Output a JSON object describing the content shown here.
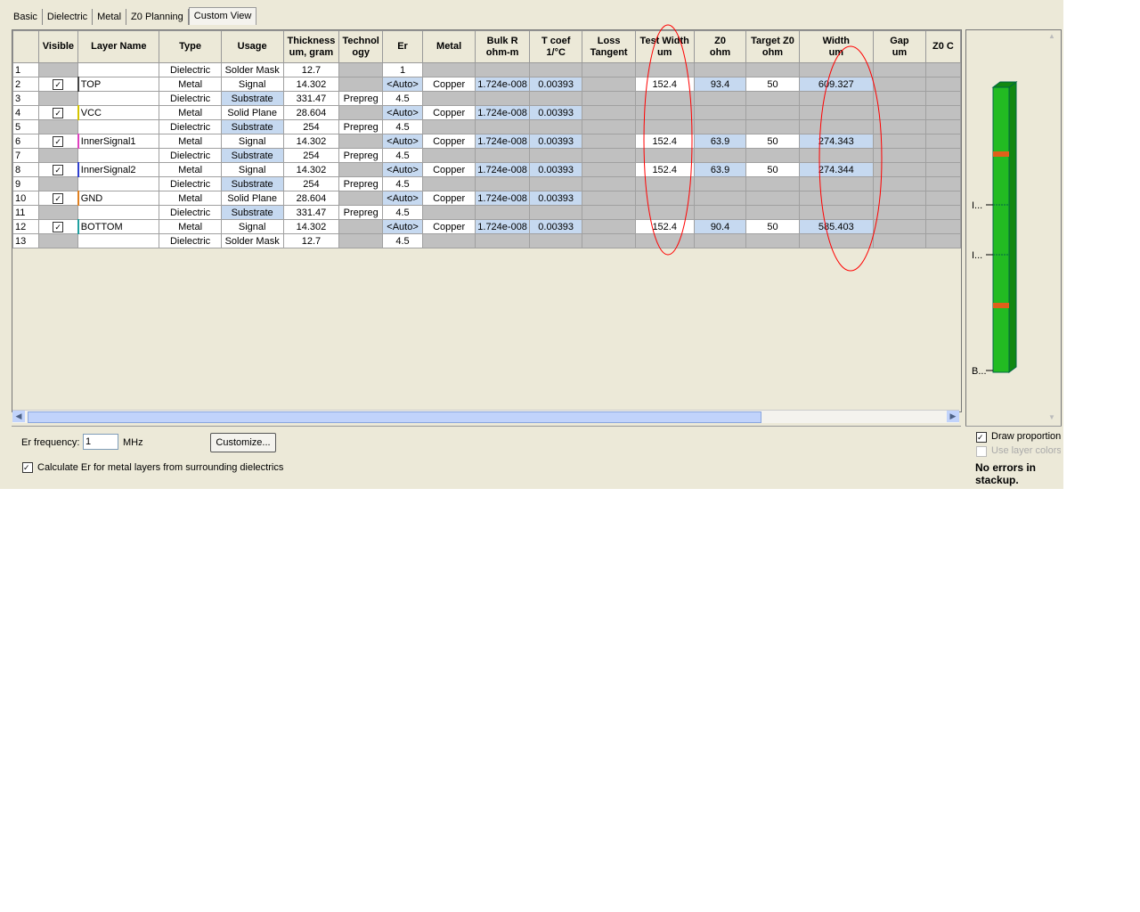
{
  "tabs": [
    "Basic",
    "Dielectric",
    "Metal",
    "Z0 Planning",
    "Custom View"
  ],
  "active_tab": 4,
  "columns": [
    "",
    "Visible",
    "Layer Name",
    "Type",
    "Usage",
    "Thickness\num, gram",
    "Technol\nogy",
    "Er",
    "Metal",
    "Bulk R\nohm-m",
    "T coef\n1/°C",
    "Loss\nTangent",
    "Test Width\num",
    "Z0\nohm",
    "Target Z0\nohm",
    "Width\num",
    "Gap\num",
    "Z0 C"
  ],
  "rows": [
    {
      "cells": [
        "1",
        "",
        "",
        "Dielectric",
        "Solder Mask",
        "12.7",
        "",
        "1",
        "",
        "",
        "",
        "",
        "",
        "",
        "",
        "",
        "",
        ""
      ],
      "cls": "ggwwwwgwgggggggggg"
    },
    {
      "cells": [
        "2",
        "☑",
        "TOP",
        "Metal",
        "Signal",
        "14.302",
        "",
        "<Auto>",
        "Copper",
        "1.724e-008",
        "0.00393",
        "",
        "152.4",
        "93.4",
        "50",
        "609.327",
        "",
        ""
      ],
      "cls": "gwwwwwgbwbbgwbwbgg"
    },
    {
      "cells": [
        "3",
        "",
        "",
        "Dielectric",
        "Substrate",
        "331.47",
        "Prepreg",
        "4.5",
        "",
        "",
        "",
        "",
        "",
        "",
        "",
        "",
        "",
        ""
      ],
      "cls": "ggwwbwwwgggggggggg"
    },
    {
      "cells": [
        "4",
        "☑",
        "VCC",
        "Metal",
        "Solid Plane",
        "28.604",
        "",
        "<Auto>",
        "Copper",
        "1.724e-008",
        "0.00393",
        "",
        "",
        "",
        "",
        "",
        "",
        ""
      ],
      "cls": "gwwwwwgbwbbggggggg"
    },
    {
      "cells": [
        "5",
        "",
        "",
        "Dielectric",
        "Substrate",
        "254",
        "Prepreg",
        "4.5",
        "",
        "",
        "",
        "",
        "",
        "",
        "",
        "",
        "",
        ""
      ],
      "cls": "ggwwbwwwgggggggggg"
    },
    {
      "cells": [
        "6",
        "☑",
        "InnerSignal1",
        "Metal",
        "Signal",
        "14.302",
        "",
        "<Auto>",
        "Copper",
        "1.724e-008",
        "0.00393",
        "",
        "152.4",
        "63.9",
        "50",
        "274.343",
        "",
        ""
      ],
      "cls": "gwwwwwgbwbbgwbwbgg"
    },
    {
      "cells": [
        "7",
        "",
        "",
        "Dielectric",
        "Substrate",
        "254",
        "Prepreg",
        "4.5",
        "",
        "",
        "",
        "",
        "",
        "",
        "",
        "",
        "",
        ""
      ],
      "cls": "ggwwbwwwgggggggggg"
    },
    {
      "cells": [
        "8",
        "☑",
        "InnerSignal2",
        "Metal",
        "Signal",
        "14.302",
        "",
        "<Auto>",
        "Copper",
        "1.724e-008",
        "0.00393",
        "",
        "152.4",
        "63.9",
        "50",
        "274.344",
        "",
        ""
      ],
      "cls": "gwwwwwgbwbbgwbwbgg"
    },
    {
      "cells": [
        "9",
        "",
        "",
        "Dielectric",
        "Substrate",
        "254",
        "Prepreg",
        "4.5",
        "",
        "",
        "",
        "",
        "",
        "",
        "",
        "",
        "",
        ""
      ],
      "cls": "ggwwbwwwgggggggggg"
    },
    {
      "cells": [
        "10",
        "☑",
        "GND",
        "Metal",
        "Solid Plane",
        "28.604",
        "",
        "<Auto>",
        "Copper",
        "1.724e-008",
        "0.00393",
        "",
        "",
        "",
        "",
        "",
        "",
        ""
      ],
      "cls": "gwwwwwgbwbbggggggg"
    },
    {
      "cells": [
        "11",
        "",
        "",
        "Dielectric",
        "Substrate",
        "331.47",
        "Prepreg",
        "4.5",
        "",
        "",
        "",
        "",
        "",
        "",
        "",
        "",
        "",
        ""
      ],
      "cls": "ggwwbwwwgggggggggg"
    },
    {
      "cells": [
        "12",
        "☑",
        "BOTTOM",
        "Metal",
        "Signal",
        "14.302",
        "",
        "<Auto>",
        "Copper",
        "1.724e-008",
        "0.00393",
        "",
        "152.4",
        "90.4",
        "50",
        "585.403",
        "",
        ""
      ],
      "cls": "gwwwwwgbwbbgwbwbgg"
    },
    {
      "cells": [
        "13",
        "",
        "",
        "Dielectric",
        "Solder Mask",
        "12.7",
        "",
        "4.5",
        "",
        "",
        "",
        "",
        "",
        "",
        "",
        "",
        "",
        ""
      ],
      "cls": "ggwwwwgwgggggggggg"
    }
  ],
  "bottom": {
    "er_label": "Er frequency:",
    "er_value": "1",
    "er_unit": "MHz",
    "customize": "Customize...",
    "calc_label": "Calculate Er for metal layers from surrounding dielectrics"
  },
  "side": {
    "labels": [
      "I...",
      "I...",
      "B..."
    ],
    "draw_prop": "Draw proportion",
    "use_colors": "Use layer colors",
    "status": "No errors in stackup."
  }
}
